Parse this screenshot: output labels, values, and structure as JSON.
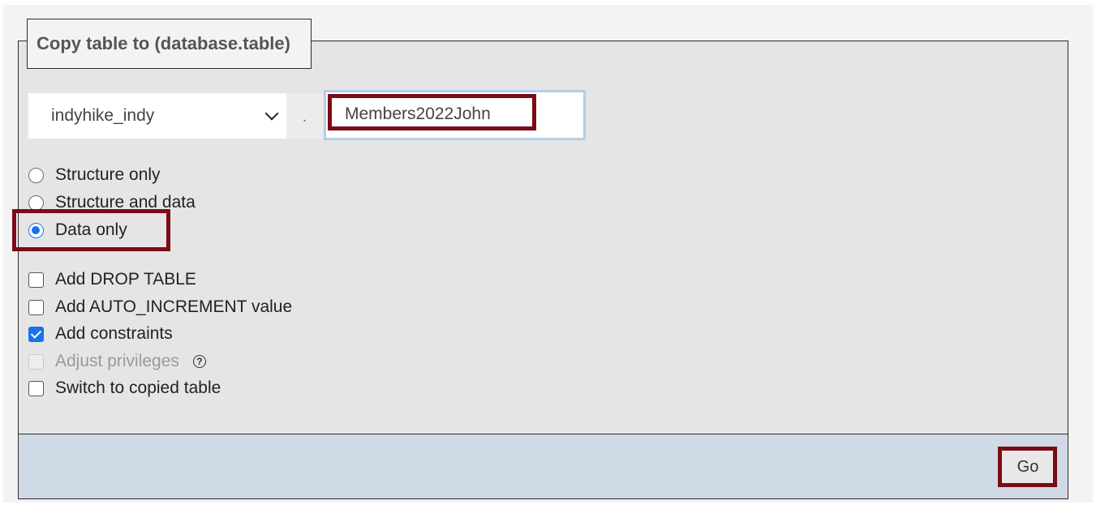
{
  "legend": {
    "title": "Copy table to (database.table)"
  },
  "target": {
    "database": "indyhike_indy",
    "separator": ".",
    "table_name": "Members2022John"
  },
  "copy_mode": {
    "options": [
      {
        "label": "Structure only",
        "checked": false
      },
      {
        "label": "Structure and data",
        "checked": false
      },
      {
        "label": "Data only",
        "checked": true
      }
    ]
  },
  "extras": {
    "options": [
      {
        "label": "Add DROP TABLE",
        "checked": false,
        "disabled": false
      },
      {
        "label": "Add AUTO_INCREMENT value",
        "checked": false,
        "disabled": false
      },
      {
        "label": "Add constraints",
        "checked": true,
        "disabled": false
      },
      {
        "label": "Adjust privileges",
        "checked": false,
        "disabled": true
      },
      {
        "label": "Switch to copied table",
        "checked": false,
        "disabled": false
      }
    ],
    "help_icon": "question-circle-icon",
    "help_glyph": "?"
  },
  "footer": {
    "go_label": "Go"
  },
  "colors": {
    "highlight": "#7a0b17",
    "accent": "#1a73e8",
    "panel": "#e5e5e5",
    "footer": "#d0d9e6"
  }
}
